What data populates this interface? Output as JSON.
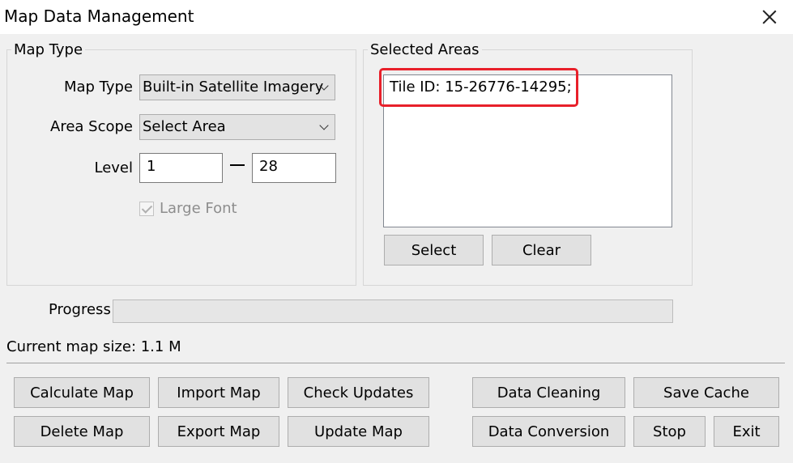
{
  "window": {
    "title": "Map Data Management"
  },
  "map_type_group": {
    "legend": "Map Type",
    "map_type_label": "Map Type",
    "map_type_value": "Built-in Satellite Imagery",
    "area_scope_label": "Area Scope",
    "area_scope_value": "Select Area",
    "level_label": "Level",
    "level_min": "1",
    "level_max": "28",
    "large_font_label": "Large Font",
    "large_font_checked": true
  },
  "selected_areas_group": {
    "legend": "Selected Areas",
    "items": [
      "Tile ID: 15-26776-14295;"
    ],
    "select_button": "Select",
    "clear_button": "Clear"
  },
  "progress": {
    "label": "Progress",
    "value": 0
  },
  "status": {
    "current_map_size": "Current map size: 1.1 M"
  },
  "buttons": {
    "calculate_map": "Calculate Map",
    "import_map": "Import Map",
    "check_updates": "Check Updates",
    "data_cleaning": "Data Cleaning",
    "save_cache": "Save Cache",
    "delete_map": "Delete Map",
    "export_map": "Export Map",
    "update_map": "Update Map",
    "data_conversion": "Data Conversion",
    "stop": "Stop",
    "exit": "Exit"
  },
  "colors": {
    "highlight": "#e8202a",
    "window_bg": "#f0f0f0"
  },
  "icons": {
    "close": "close-icon",
    "dropdown": "chevron-down-icon",
    "check": "checkmark-icon"
  }
}
